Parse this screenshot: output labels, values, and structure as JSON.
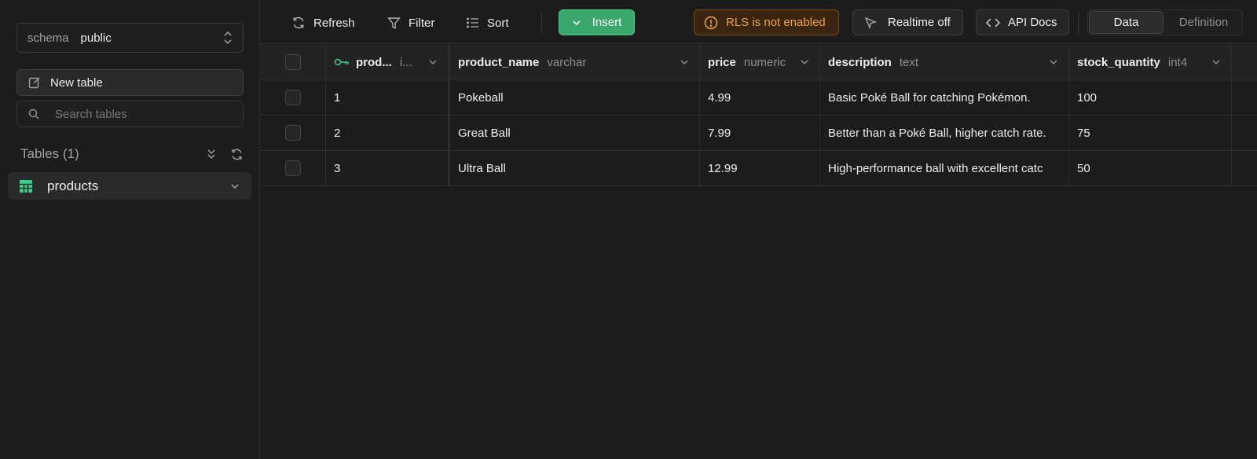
{
  "sidebar": {
    "schema_label": "schema",
    "schema_value": "public",
    "new_table_label": "New table",
    "search_placeholder": "Search tables",
    "tables_heading": "Tables (1)",
    "tables": [
      {
        "label": "products"
      }
    ]
  },
  "toolbar": {
    "refresh_label": "Refresh",
    "filter_label": "Filter",
    "sort_label": "Sort",
    "insert_label": "Insert",
    "rls_label": "RLS is not enabled",
    "realtime_label": "Realtime off",
    "api_docs_label": "API Docs",
    "view_data_label": "Data",
    "view_definition_label": "Definition"
  },
  "grid": {
    "columns": [
      {
        "name": "prod...",
        "type": "i...",
        "primary_key": true
      },
      {
        "name": "product_name",
        "type": "varchar"
      },
      {
        "name": "price",
        "type": "numeric"
      },
      {
        "name": "description",
        "type": "text"
      },
      {
        "name": "stock_quantity",
        "type": "int4"
      }
    ],
    "rows": [
      [
        "1",
        "Pokeball",
        "4.99",
        "Basic Poké Ball for catching Pokémon.",
        "100"
      ],
      [
        "2",
        "Great Ball",
        "7.99",
        "Better than a Poké Ball, higher catch rate.",
        "75"
      ],
      [
        "3",
        "Ultra Ball",
        "12.99",
        "High-performance ball with excellent catc",
        "50"
      ]
    ]
  },
  "colors": {
    "accent_green": "#3aa76d",
    "warning_orange": "#f1a340",
    "background": "#1c1c1c"
  },
  "icons": [
    "refresh-icon",
    "filter-icon",
    "sort-icon",
    "chevron-down-icon",
    "warning-icon",
    "cursor-icon",
    "code-icon",
    "key-icon",
    "table-icon",
    "edit-icon",
    "search-icon",
    "collapse-icon"
  ]
}
